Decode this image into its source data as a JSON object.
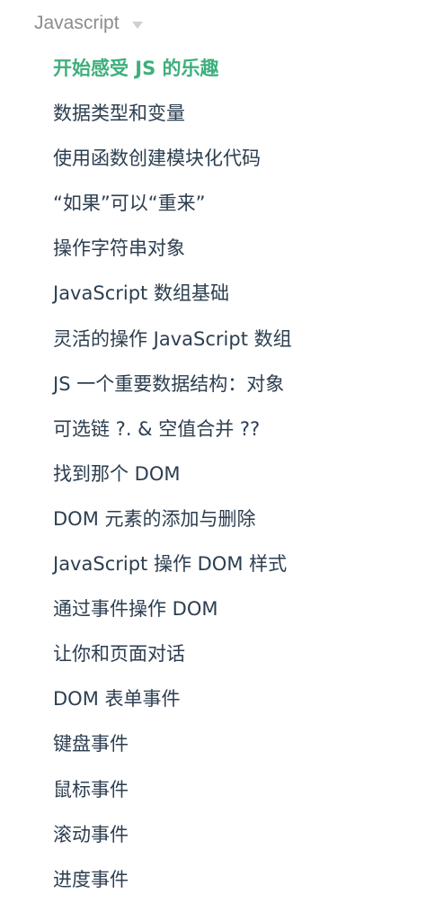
{
  "sidebar": {
    "group": {
      "title": "Javascript",
      "toggle_icon": "caret-down-icon"
    },
    "active_index": 0,
    "accent_color": "#3eaf7c",
    "text_color": "#2c3e50",
    "items": [
      {
        "label": "开始感受 JS 的乐趣"
      },
      {
        "label": "数据类型和变量"
      },
      {
        "label": "使用函数创建模块化代码"
      },
      {
        "label": "“如果”可以“重来”"
      },
      {
        "label": "操作字符串对象"
      },
      {
        "label": "JavaScript 数组基础"
      },
      {
        "label": "灵活的操作 JavaScript 数组"
      },
      {
        "label": "JS 一个重要数据结构：对象"
      },
      {
        "label": "可选链 ?. & 空值合并 ??"
      },
      {
        "label": "找到那个 DOM"
      },
      {
        "label": "DOM 元素的添加与删除"
      },
      {
        "label": "JavaScript 操作 DOM 样式"
      },
      {
        "label": "通过事件操作 DOM"
      },
      {
        "label": "让你和页面对话"
      },
      {
        "label": "DOM 表单事件"
      },
      {
        "label": "键盘事件"
      },
      {
        "label": "鼠标事件"
      },
      {
        "label": "滚动事件"
      },
      {
        "label": "进度事件"
      }
    ]
  }
}
